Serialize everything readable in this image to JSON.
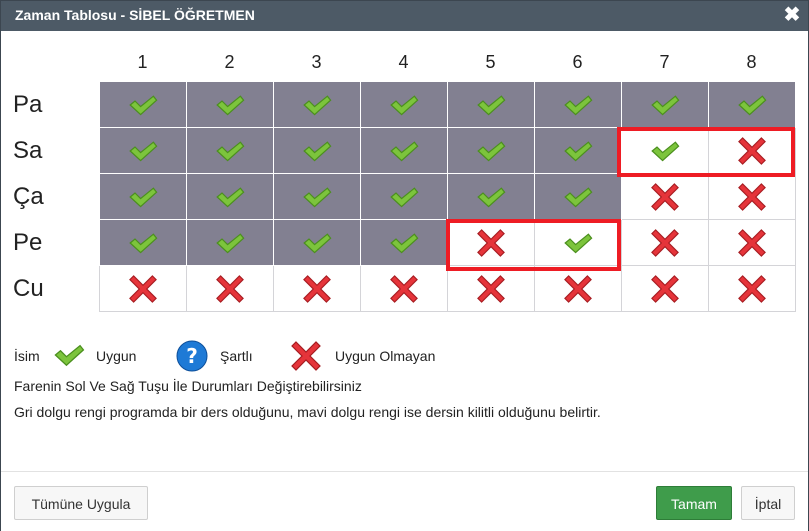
{
  "window": {
    "title": "Zaman Tablosu - SİBEL ÖĞRETMEN",
    "close_symbol": "✖"
  },
  "timetable": {
    "columns": [
      "1",
      "2",
      "3",
      "4",
      "5",
      "6",
      "7",
      "8"
    ],
    "rows": [
      {
        "label": "Pa",
        "cells": [
          {
            "state": "uygun",
            "busy": true
          },
          {
            "state": "uygun",
            "busy": true
          },
          {
            "state": "uygun",
            "busy": true
          },
          {
            "state": "uygun",
            "busy": true
          },
          {
            "state": "uygun",
            "busy": true
          },
          {
            "state": "uygun",
            "busy": true
          },
          {
            "state": "uygun",
            "busy": true
          },
          {
            "state": "uygun",
            "busy": true
          }
        ]
      },
      {
        "label": "Sa",
        "cells": [
          {
            "state": "uygun",
            "busy": true
          },
          {
            "state": "uygun",
            "busy": true
          },
          {
            "state": "uygun",
            "busy": true
          },
          {
            "state": "uygun",
            "busy": true
          },
          {
            "state": "uygun",
            "busy": true
          },
          {
            "state": "uygun",
            "busy": true
          },
          {
            "state": "uygun",
            "busy": false
          },
          {
            "state": "uygun-olmayan",
            "busy": false
          }
        ]
      },
      {
        "label": "Ça",
        "cells": [
          {
            "state": "uygun",
            "busy": true
          },
          {
            "state": "uygun",
            "busy": true
          },
          {
            "state": "uygun",
            "busy": true
          },
          {
            "state": "uygun",
            "busy": true
          },
          {
            "state": "uygun",
            "busy": true
          },
          {
            "state": "uygun",
            "busy": true
          },
          {
            "state": "uygun-olmayan",
            "busy": false
          },
          {
            "state": "uygun-olmayan",
            "busy": false
          }
        ]
      },
      {
        "label": "Pe",
        "cells": [
          {
            "state": "uygun",
            "busy": true
          },
          {
            "state": "uygun",
            "busy": true
          },
          {
            "state": "uygun",
            "busy": true
          },
          {
            "state": "uygun",
            "busy": true
          },
          {
            "state": "uygun-olmayan",
            "busy": false
          },
          {
            "state": "uygun",
            "busy": false
          },
          {
            "state": "uygun-olmayan",
            "busy": false
          },
          {
            "state": "uygun-olmayan",
            "busy": false
          }
        ]
      },
      {
        "label": "Cu",
        "cells": [
          {
            "state": "uygun-olmayan",
            "busy": false
          },
          {
            "state": "uygun-olmayan",
            "busy": false
          },
          {
            "state": "uygun-olmayan",
            "busy": false
          },
          {
            "state": "uygun-olmayan",
            "busy": false
          },
          {
            "state": "uygun-olmayan",
            "busy": false
          },
          {
            "state": "uygun-olmayan",
            "busy": false
          },
          {
            "state": "uygun-olmayan",
            "busy": false
          },
          {
            "state": "uygun-olmayan",
            "busy": false
          }
        ]
      }
    ],
    "busy_color": "#828091",
    "highlight_color": "#ee1c24"
  },
  "legend": {
    "name_label": "İsim",
    "available_label": "Uygun",
    "conditional_label": "Şartlı",
    "unavailable_label": "Uygun Olmayan",
    "available_icon": "check-icon",
    "conditional_icon": "question-icon",
    "unavailable_icon": "cross-icon"
  },
  "notes": {
    "line1": "Farenin Sol Ve Sağ Tuşu İle Durumları Değiştirebilirsiniz",
    "line2": "Gri dolgu rengi programda bir ders olduğunu, mavi dolgu rengi ise dersin kilitli olduğunu belirtir."
  },
  "footer": {
    "apply_all_label": "Tümüne Uygula",
    "ok_label": "Tamam",
    "cancel_label": "İptal"
  }
}
